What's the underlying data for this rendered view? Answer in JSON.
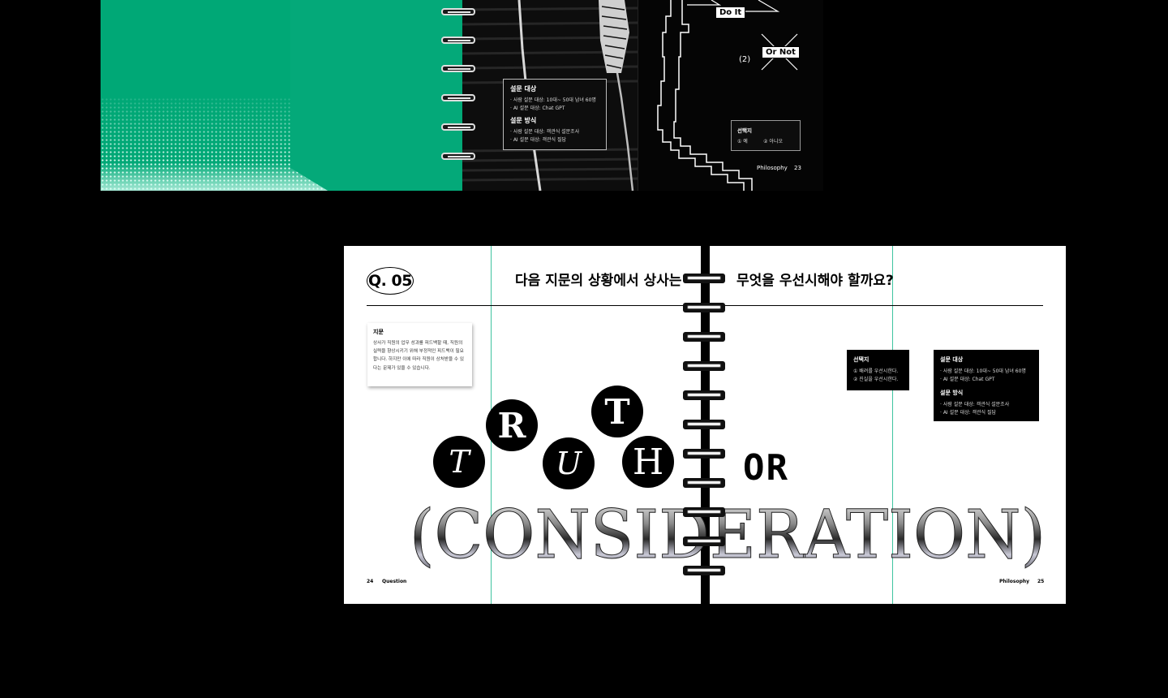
{
  "top_spread": {
    "tag_do_it": "Do It",
    "tag_or_not": "Or Not",
    "option_number": "(2)",
    "survey_box": {
      "target_heading": "설문 대상",
      "target_lines": [
        "· 사람 설문 대상: 10대~ 50대 남녀 60명",
        "· AI 설문 대상: Chat GPT"
      ],
      "method_heading": "설문 방식",
      "method_lines": [
        "· 사람 설문 대상: 객관식 설문조사",
        "· AI 설문 대상: 객관식 질답"
      ]
    },
    "choice_box": {
      "heading": "선택지",
      "opt1": "① 예",
      "opt2": "② 아니오"
    },
    "footer_label": "Philosophy",
    "footer_page": "23"
  },
  "bottom_spread": {
    "q_label": "Q. 05",
    "question_left": "다음 지문의 상황에서 상사는",
    "question_right": "무엇을 우선시해야 할까요?",
    "jimun": {
      "heading": "지문",
      "body": "상사가 직원의 업무 성과를 피드백할 때, 직원의 실력을 향상시키기 위해 부정적인 피드백이 필요합니다. 하지만 이에 따라 직원이 상처받을 수 있다는 문제가 있을 수 있습니다."
    },
    "choices": {
      "heading": "선택지",
      "opt1": "① 배려를 우선시한다.",
      "opt2": "② 진실을 우선시한다."
    },
    "survey": {
      "target_heading": "설문 대상",
      "target_lines": [
        "· 사람 설문 대상: 10대~ 50대 남녀 60명",
        "· AI 설문 대상: Chat GPT"
      ],
      "method_heading": "설문 방식",
      "method_lines": [
        "· 사람 설문 대상: 객관식 설문조사",
        "· AI 설문 대상: 객관식 질답"
      ]
    },
    "truth_letters": [
      "T",
      "R",
      "U",
      "T",
      "H"
    ],
    "or_word": "OR",
    "consideration_word": "(CONSIDERATION)",
    "footer_left_page": "24",
    "footer_left_label": "Question",
    "footer_right_label": "Philosophy",
    "footer_right_page": "25"
  },
  "colors": {
    "green": "#00a876",
    "teal_line": "#3fc4a0",
    "black": "#000000",
    "white": "#ffffff"
  }
}
